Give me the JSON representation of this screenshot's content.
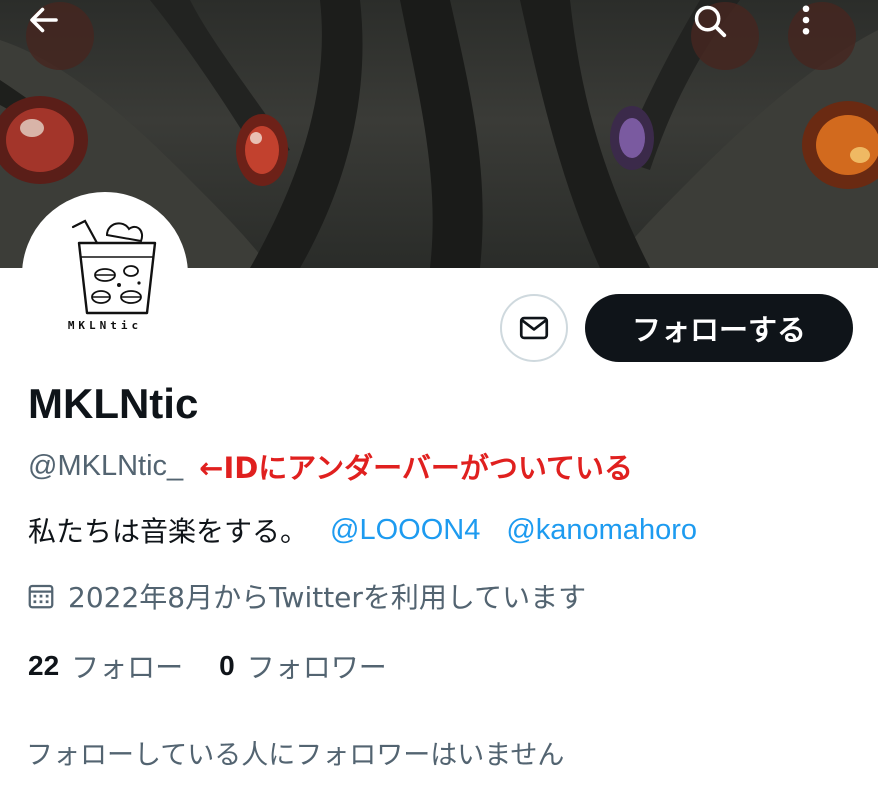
{
  "header": {
    "back_icon": "arrow-left-icon",
    "search_icon": "search-icon",
    "more_icon": "more-vertical-icon",
    "button_bg": "#46261f"
  },
  "avatar": {
    "logo_text": "MKLNtic"
  },
  "actions": {
    "message_icon": "envelope-icon",
    "follow_label": "フォローする"
  },
  "profile": {
    "display_name": "MKLNtic",
    "handle": "@MKLNtic_",
    "annotation": "←IDにアンダーバーがついている",
    "annotation_color": "#e0201f",
    "bio": "私たちは音楽をする。",
    "mentions": [
      "@LOOON4",
      "@kanomahoro"
    ],
    "joined_icon": "calendar-icon",
    "joined": "2022年8月からTwitterを利用しています"
  },
  "stats": {
    "following_count": "22",
    "following_label": "フォロー",
    "followers_count": "0",
    "followers_label": "フォロワー"
  },
  "footer": {
    "no_followers_text": "フォローしている人にフォロワーはいません"
  },
  "colors": {
    "text_primary": "#0f1419",
    "text_secondary": "#536471",
    "link": "#1d9bf0",
    "follow_button": "#0f1419"
  }
}
